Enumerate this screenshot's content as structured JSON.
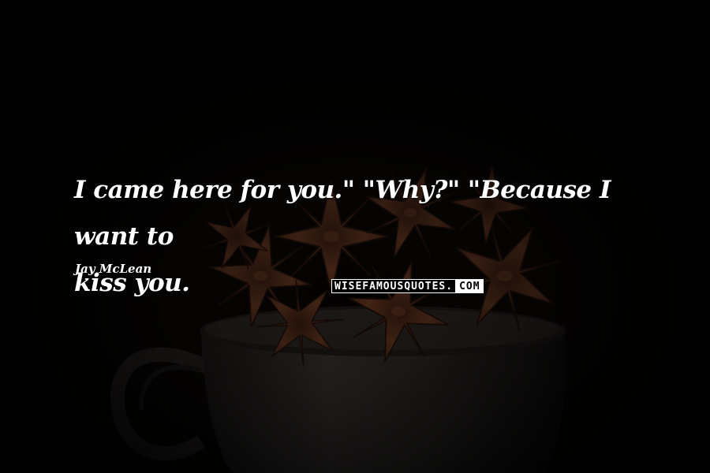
{
  "quote": {
    "line1": "I came here for you.\" \"Why?\" \"Because I want to",
    "line2": "kiss you."
  },
  "author": "Jay McLean",
  "watermark": {
    "main": "WISEFAMOUSQUOTES.",
    "tld": "COM"
  },
  "colors": {
    "background": "#000000",
    "text": "#ffffff",
    "anise": "#5a2e1c",
    "cup": "#2e2b28"
  }
}
